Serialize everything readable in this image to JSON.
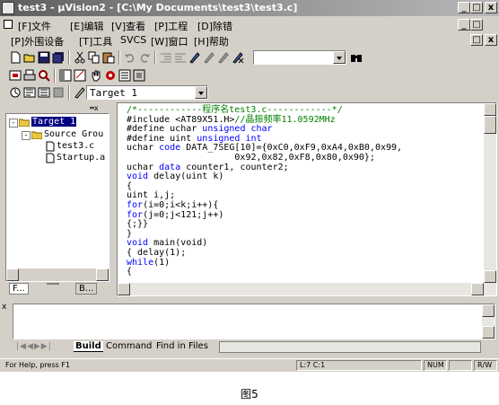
{
  "window": {
    "title": "test3 - µVision2 - [C:\\My Documents\\test3\\test3.c]",
    "caption_buttons": [
      "_",
      "□",
      "x"
    ]
  },
  "menu_row1": [
    {
      "label": "[F]文件"
    },
    {
      "label": "[E]编辑"
    },
    {
      "label": "[V]查看"
    },
    {
      "label": "[P]工程"
    },
    {
      "label": "[D]除错"
    }
  ],
  "menu_row2": [
    {
      "label": "[P]外围设备"
    },
    {
      "label": "[T]工具"
    },
    {
      "label": "SVCS"
    },
    {
      "label": "[W]窗口"
    },
    {
      "label": "[H]帮助"
    }
  ],
  "toolbar": {
    "find_combo_value": "",
    "target_combo_value": "Target 1",
    "icons": [
      "new-file-icon",
      "open-file-icon",
      "save-icon",
      "save-all-icon",
      "cut-icon",
      "copy-icon",
      "paste-icon",
      "undo-icon",
      "redo-icon",
      "indent-icon",
      "outdent-icon",
      "bookmark-icon",
      "bookmark-prev-icon",
      "bookmark-next-icon",
      "bookmark-clear-icon",
      "find-icon"
    ]
  },
  "project": {
    "items": [
      {
        "label": "Target 1"
      },
      {
        "label": "Source Grou"
      },
      {
        "label": "test3.c"
      },
      {
        "label": "Startup.a"
      }
    ],
    "tabs": [
      {
        "label": "F..."
      },
      {
        "label": ""
      },
      {
        "label": "B..."
      }
    ]
  },
  "editor": {
    "lines": [
      {
        "parts": [
          {
            "t": "/*------------程序名test3.c------------*/",
            "c": "cm"
          }
        ]
      },
      {
        "parts": [
          {
            "t": "#include <AT89X51.H>",
            "c": ""
          },
          {
            "t": "//晶振频率11.0592MHz",
            "c": "cm"
          }
        ]
      },
      {
        "parts": [
          {
            "t": "#define uchar ",
            "c": ""
          },
          {
            "t": "unsigned char",
            "c": "kw"
          }
        ]
      },
      {
        "parts": [
          {
            "t": "#define uint ",
            "c": ""
          },
          {
            "t": "unsigned int",
            "c": "kw"
          }
        ]
      },
      {
        "parts": [
          {
            "t": "uchar ",
            "c": ""
          },
          {
            "t": "code",
            "c": "kw"
          },
          {
            "t": " DATA_7SEG[10]={0xC0,0xF9,0xA4,0xB0,0x99,",
            "c": ""
          }
        ]
      },
      {
        "parts": [
          {
            "t": "                    0x92,0x82,0xF8,0x80,0x90};",
            "c": ""
          }
        ]
      },
      {
        "parts": [
          {
            "t": "uchar ",
            "c": ""
          },
          {
            "t": "data",
            "c": "kw"
          },
          {
            "t": " counter1, counter2;",
            "c": ""
          }
        ]
      },
      {
        "parts": [
          {
            "t": "void",
            "c": "kw"
          },
          {
            "t": " delay(uint k)",
            "c": ""
          }
        ]
      },
      {
        "parts": [
          {
            "t": "{",
            "c": ""
          }
        ]
      },
      {
        "parts": [
          {
            "t": "uint i,j;",
            "c": ""
          }
        ]
      },
      {
        "parts": [
          {
            "t": "for",
            "c": "kw"
          },
          {
            "t": "(i=0;i<k;i++){",
            "c": ""
          }
        ]
      },
      {
        "parts": [
          {
            "t": "for",
            "c": "kw"
          },
          {
            "t": "(j=0;j<121;j++)",
            "c": ""
          }
        ]
      },
      {
        "parts": [
          {
            "t": "{;}}",
            "c": ""
          }
        ]
      },
      {
        "parts": [
          {
            "t": "}",
            "c": ""
          }
        ]
      },
      {
        "parts": [
          {
            "t": "void",
            "c": "kw"
          },
          {
            "t": " main(void)",
            "c": ""
          }
        ]
      },
      {
        "parts": [
          {
            "t": "{ delay(1);",
            "c": ""
          }
        ]
      },
      {
        "parts": [
          {
            "t": "while",
            "c": "kw"
          },
          {
            "t": "(1)",
            "c": ""
          }
        ]
      },
      {
        "parts": [
          {
            "t": "{",
            "c": ""
          }
        ]
      }
    ]
  },
  "output": {
    "tabs": [
      {
        "label": "Build"
      },
      {
        "label": "Command"
      },
      {
        "label": "Find in Files"
      }
    ]
  },
  "status": {
    "help": "For Help, press F1",
    "position": "L:7 C:1",
    "num": "NUM",
    "mode": "R/W"
  },
  "caption": "图5"
}
